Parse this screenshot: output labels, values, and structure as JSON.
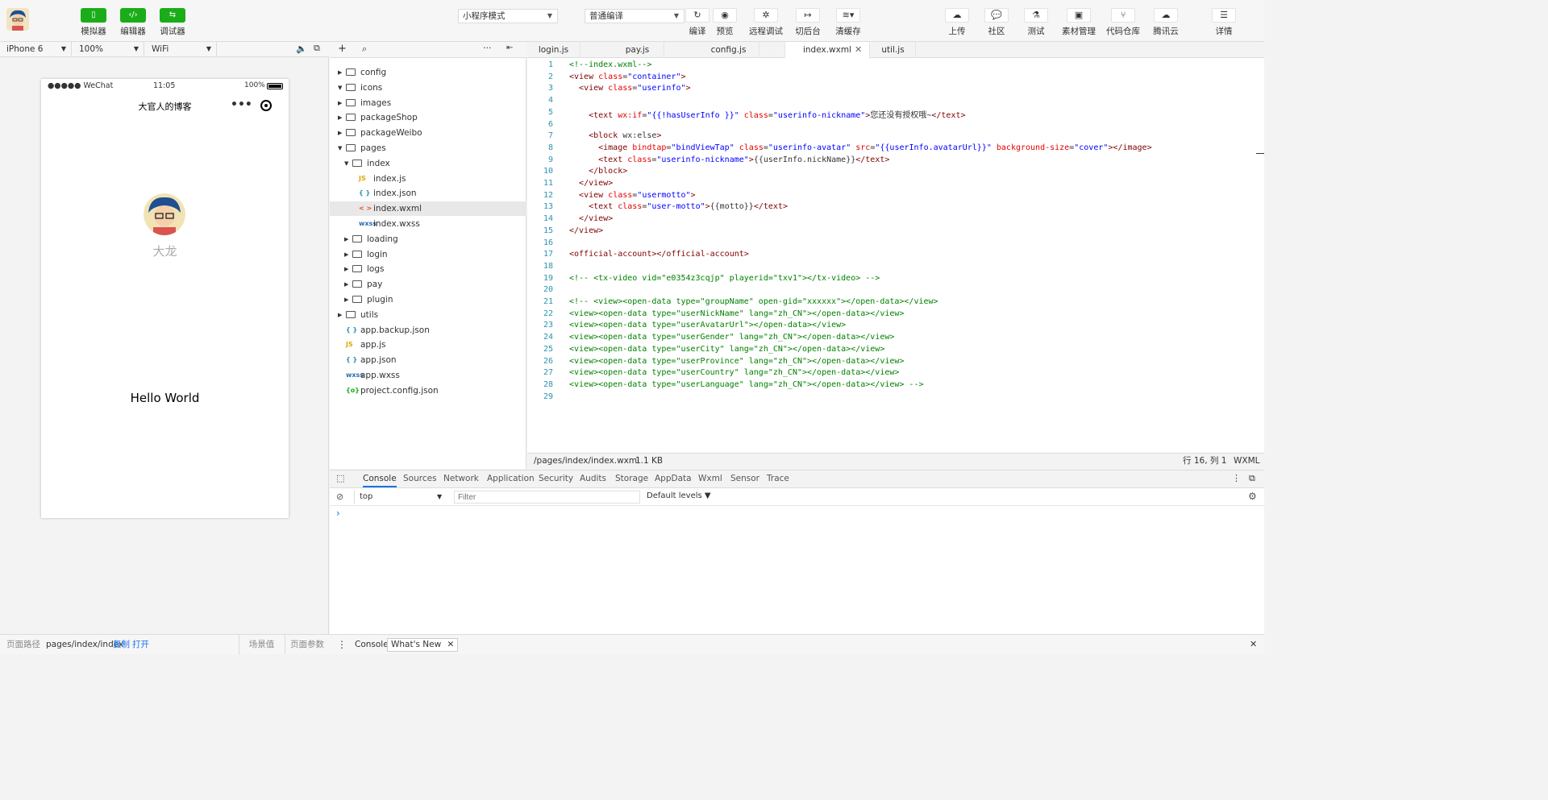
{
  "toolbar": {
    "left_buttons": [
      {
        "label": "模拟器",
        "icon": "phone-icon"
      },
      {
        "label": "编辑器",
        "icon": "code-icon"
      },
      {
        "label": "调试器",
        "icon": "debug-icon"
      }
    ],
    "mode_select": "小程序模式",
    "compile_select": "普通编译",
    "center_buttons": [
      {
        "label": "编译",
        "icon": "refresh-icon"
      },
      {
        "label": "预览",
        "icon": "eye-icon"
      },
      {
        "label": "远程调试",
        "icon": "bug-icon"
      },
      {
        "label": "切后台",
        "icon": "switch-icon"
      },
      {
        "label": "清缓存",
        "icon": "layers-icon"
      }
    ],
    "right_buttons": [
      {
        "label": "上传",
        "icon": "cloud-upload-icon"
      },
      {
        "label": "社区",
        "icon": "chat-icon"
      },
      {
        "label": "测试",
        "icon": "flask-icon"
      },
      {
        "label": "素材管理",
        "icon": "material-icon"
      },
      {
        "label": "代码仓库",
        "icon": "git-icon"
      },
      {
        "label": "腾讯云",
        "icon": "cloud-icon"
      },
      {
        "label": "详情",
        "icon": "menu-icon"
      }
    ]
  },
  "device_bar": {
    "device": "iPhone 6",
    "zoom": "100%",
    "network": "WiFi"
  },
  "phone": {
    "carrier": "●●●●● WeChat",
    "time": "11:05",
    "battery": "100%",
    "nav_title": "大官人的博客",
    "nickname": "大龙",
    "motto": "Hello World"
  },
  "file_tree": [
    {
      "name": "config",
      "type": "folder",
      "depth": 0,
      "open": false
    },
    {
      "name": "icons",
      "type": "folder",
      "depth": 0,
      "open": true
    },
    {
      "name": "images",
      "type": "folder",
      "depth": 0,
      "open": false
    },
    {
      "name": "packageShop",
      "type": "folder",
      "depth": 0,
      "open": false
    },
    {
      "name": "packageWeibo",
      "type": "folder",
      "depth": 0,
      "open": false
    },
    {
      "name": "pages",
      "type": "folder",
      "depth": 0,
      "open": true
    },
    {
      "name": "index",
      "type": "folder",
      "depth": 1,
      "open": true
    },
    {
      "name": "index.js",
      "type": "js",
      "depth": 2
    },
    {
      "name": "index.json",
      "type": "json",
      "depth": 2
    },
    {
      "name": "index.wxml",
      "type": "wxml",
      "depth": 2,
      "selected": true
    },
    {
      "name": "index.wxss",
      "type": "wxss",
      "depth": 2
    },
    {
      "name": "loading",
      "type": "folder",
      "depth": 1,
      "open": false
    },
    {
      "name": "login",
      "type": "folder",
      "depth": 1,
      "open": false
    },
    {
      "name": "logs",
      "type": "folder",
      "depth": 1,
      "open": false
    },
    {
      "name": "pay",
      "type": "folder",
      "depth": 1,
      "open": false
    },
    {
      "name": "plugin",
      "type": "folder",
      "depth": 1,
      "open": false
    },
    {
      "name": "utils",
      "type": "folder",
      "depth": 0,
      "open": false
    },
    {
      "name": "app.backup.json",
      "type": "json",
      "depth": 0
    },
    {
      "name": "app.js",
      "type": "js",
      "depth": 0
    },
    {
      "name": "app.json",
      "type": "json",
      "depth": 0
    },
    {
      "name": "app.wxss",
      "type": "wxss",
      "depth": 0
    },
    {
      "name": "project.config.json",
      "type": "config",
      "depth": 0
    }
  ],
  "icon_glyphs": {
    "js": "JS",
    "json": "{ }",
    "wxml": "< >",
    "wxss": "wxss",
    "config": "{o}"
  },
  "icon_colors": {
    "js": "#e0a800",
    "json": "#2b91af",
    "wxml": "#e44d26",
    "wxss": "#2b6cb0",
    "config": "#1aad19"
  },
  "editor_tabs": [
    {
      "label": "login.js",
      "active": false
    },
    {
      "label": "pay.js",
      "active": false
    },
    {
      "label": "config.js",
      "active": false
    },
    {
      "label": "index.wxml",
      "active": true
    },
    {
      "label": "util.js",
      "active": false
    }
  ],
  "code_lines": [
    "<!--index.wxml-->",
    "<view class=\"container\">",
    "  <view class=\"userinfo\">",
    "",
    "    <text wx:if=\"{{!hasUserInfo }}\" class=\"userinfo-nickname\">您还没有授权哦~</text>",
    "",
    "    <block wx:else>",
    "      <image bindtap=\"bindViewTap\" class=\"userinfo-avatar\" src=\"{{userInfo.avatarUrl}}\" background-size=\"cover\"></image>",
    "      <text class=\"userinfo-nickname\">{{userInfo.nickName}}</text>",
    "    </block>",
    "  </view>",
    "  <view class=\"usermotto\">",
    "    <text class=\"user-motto\">{{motto}}</text>",
    "  </view>",
    "</view>",
    "",
    "<official-account></official-account>",
    "",
    "<!-- <tx-video vid=\"e0354z3cqjp\" playerid=\"txv1\"></tx-video> -->",
    "",
    "<!-- <view><open-data type=\"groupName\" open-gid=\"xxxxxx\"></open-data></view>",
    "<view><open-data type=\"userNickName\" lang=\"zh_CN\"></open-data></view>",
    "<view><open-data type=\"userAvatarUrl\"></open-data></view>",
    "<view><open-data type=\"userGender\" lang=\"zh_CN\"></open-data></view>",
    "<view><open-data type=\"userCity\" lang=\"zh_CN\"></open-data></view>",
    "<view><open-data type=\"userProvince\" lang=\"zh_CN\"></open-data></view>",
    "<view><open-data type=\"userCountry\" lang=\"zh_CN\"></open-data></view>",
    "<view><open-data type=\"userLanguage\" lang=\"zh_CN\"></open-data></view> -->",
    ""
  ],
  "status": {
    "path": "/pages/index/index.wxml",
    "size": "1.1 KB",
    "cursor": "行 16, 列 1",
    "language": "WXML"
  },
  "debugger": {
    "tabs": [
      "Console",
      "Sources",
      "Network",
      "Application",
      "Security",
      "Audits",
      "Storage",
      "AppData",
      "Wxml",
      "Sensor",
      "Trace"
    ],
    "active_tab": "Console",
    "context": "top",
    "filter_placeholder": "Filter",
    "levels": "Default levels ▼",
    "prompt": "›"
  },
  "bottom_bar": {
    "path_label": "页面路径",
    "path": "pages/index/index",
    "copy": "复制",
    "open": "打开",
    "scene": "场景值",
    "params": "页面参数",
    "drawer_tabs": [
      "Console",
      "What's New"
    ]
  },
  "colors": {
    "green": "#1aad19",
    "accent": "#1a73e8"
  }
}
